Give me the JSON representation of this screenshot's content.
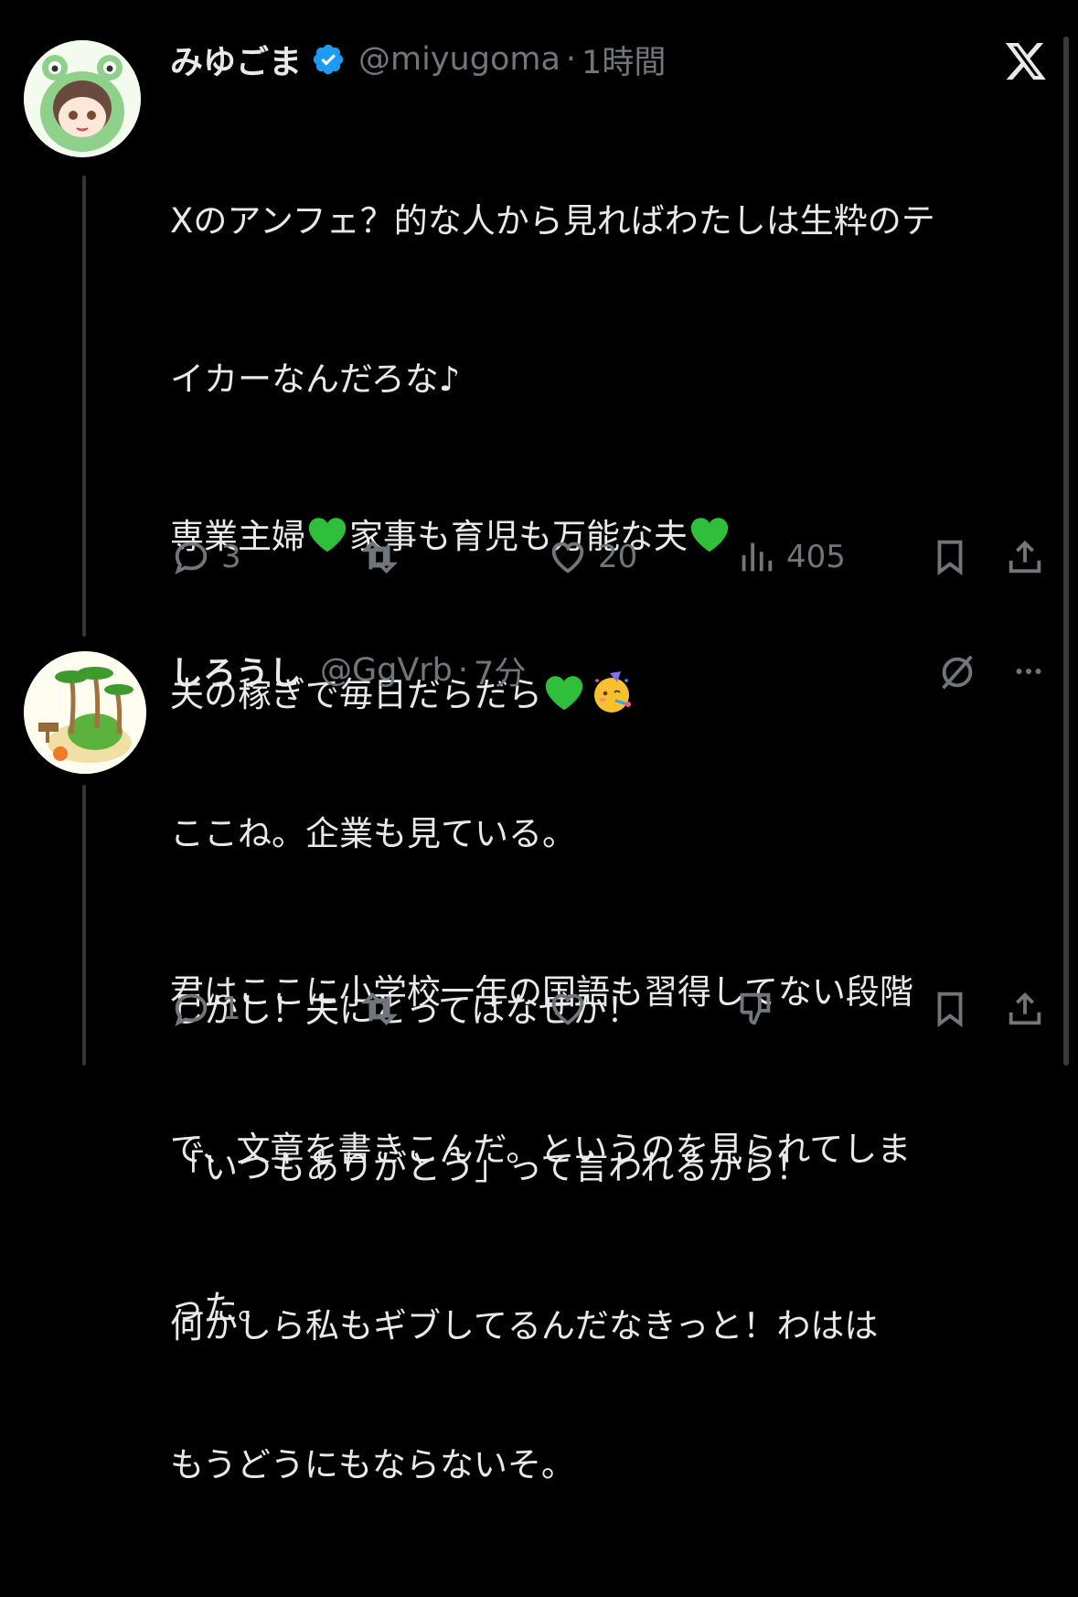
{
  "window": {
    "close_icon": "x-logo-icon"
  },
  "tweet1": {
    "name": "みゆごま",
    "verified_icon": "verified-badge-icon",
    "verified_color": "#1d9bf0",
    "handle": "@miyugoma",
    "separator": "·",
    "time": "1時間",
    "lines": [
      "Xのアンフェ？的な人から見ればわたしは生粋のテ",
      "イカーなんだろな♪",
      "専業主婦",
      "家事も育児も万能な夫",
      "夫の稼ぎで毎日だらだら",
      "しかし！夫にとってはなぜか！",
      "「いつもありがとう」って言われるから！",
      "何かしら私もギブしてるんだなきっと！わはは"
    ],
    "emoji": {
      "heart": "green-heart-emoji",
      "party": "partying-face-emoji",
      "heart_color": "#2fbf3b"
    },
    "stats": {
      "replies": "3",
      "reposts": "",
      "likes": "20",
      "views": "405"
    }
  },
  "tweet2": {
    "name": "しろうし",
    "handle": "@GgVrb",
    "separator": "·",
    "time": "7分",
    "lines": [
      "ここね。企業も見ている。",
      "君はここに小学校一年の国語も習得してない段階",
      "で、文章を書きこんだ。というのを見られてしま",
      "った。",
      "もうどうにもならないそ。"
    ],
    "stats": {
      "replies": "1",
      "reposts": "",
      "likes": ""
    }
  },
  "colors": {
    "background": "#000000",
    "text": "#e7e9ea",
    "muted": "#71767b",
    "thread_line": "#333639"
  }
}
